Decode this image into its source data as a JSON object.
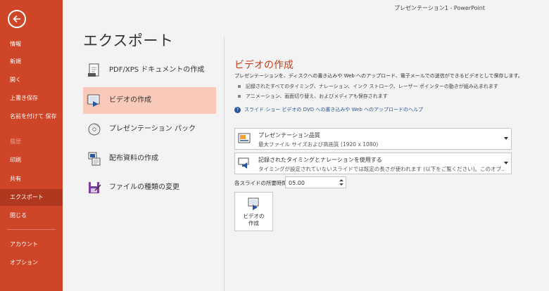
{
  "window_title": "プレゼンテーション1 - PowerPoint",
  "page_title": "エクスポート",
  "sidebar": {
    "back_icon": "back-arrow-icon",
    "items": [
      {
        "label": "情報"
      },
      {
        "label": "新規"
      },
      {
        "label": "開く"
      },
      {
        "label": "上書き保存"
      },
      {
        "label": "名前を付けて\n保存"
      },
      {
        "label": "履歴",
        "disabled": true
      },
      {
        "label": "印刷"
      },
      {
        "label": "共有"
      },
      {
        "label": "エクスポート",
        "active": true
      },
      {
        "label": "閉じる"
      },
      {
        "label": "アカウント"
      },
      {
        "label": "オプション"
      }
    ]
  },
  "export_options": [
    {
      "label": "PDF/XPS ドキュメントの作成",
      "icon": "pdf-document-icon"
    },
    {
      "label": "ビデオの作成",
      "icon": "video-icon",
      "selected": true
    },
    {
      "label": "プレゼンテーション パック",
      "icon": "cd-package-icon"
    },
    {
      "label": "配布資料の作成",
      "icon": "handouts-icon"
    },
    {
      "label": "ファイルの種類の変更",
      "icon": "file-type-change-icon"
    }
  ],
  "detail": {
    "title": "ビデオの作成",
    "description": "プレゼンテーションを、ディスクへの書き込みや Web へのアップロード、電子メールでの送信ができるビデオとして保存します。",
    "bullets": [
      "記録されたすべてのタイミング、ナレーション、インク ストローク、レーザー ポインターの動きが組み込まれます",
      "アニメーション、画面切り替え、およびメディアも保存されます"
    ],
    "help_link": "スライド ショー ビデオの DVD への書き込みや Web へのアップロードのヘルプ",
    "quality_dropdown": {
      "title": "プレゼンテーション品質",
      "subtitle": "最大ファイル サイズおよび高画質 (1920 x 1080)",
      "icon": "quality-icon"
    },
    "timing_dropdown": {
      "title": "記録されたタイミングとナレーションを使用する",
      "subtitle": "タイミングが設定されていないスライドでは既定の長さが使われます (以下をご覧ください)。このオプ...",
      "icon": "narration-icon"
    },
    "seconds_label": "各スライドの所要時間 (秒):",
    "seconds_value": "05.00",
    "create_button": "ビデオの\n作成"
  },
  "colors": {
    "sidebar": "#cf4528",
    "sidebar_active": "#b0381e",
    "selected_option": "#f9c9b9",
    "accent_title": "#c43e1c",
    "link": "#2b579a"
  }
}
